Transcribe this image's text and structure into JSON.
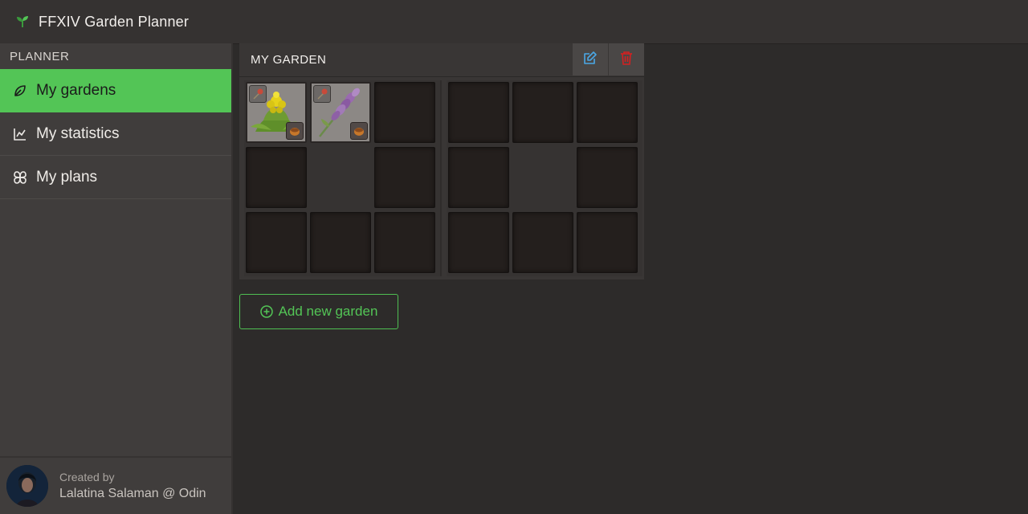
{
  "app": {
    "title": "FFXIV Garden Planner",
    "logo_icon": "sprout-icon"
  },
  "sidebar": {
    "section_label": "PLANNER",
    "items": [
      {
        "label": "My gardens",
        "icon": "leaf-icon",
        "active": true
      },
      {
        "label": "My statistics",
        "icon": "chart-icon",
        "active": false
      },
      {
        "label": "My plans",
        "icon": "clover-icon",
        "active": false
      }
    ],
    "footer": {
      "created_label": "Created by",
      "author": "Lalatina Salaman @ Odin"
    }
  },
  "garden": {
    "title": "MY GARDEN",
    "edit_icon": "edit-icon",
    "delete_icon": "trash-icon"
  },
  "actions": {
    "add_garden_label": "Add new garden"
  },
  "colors": {
    "accent_green": "#53c556",
    "edit_blue": "#4aa8e6",
    "delete_red": "#d42020"
  }
}
